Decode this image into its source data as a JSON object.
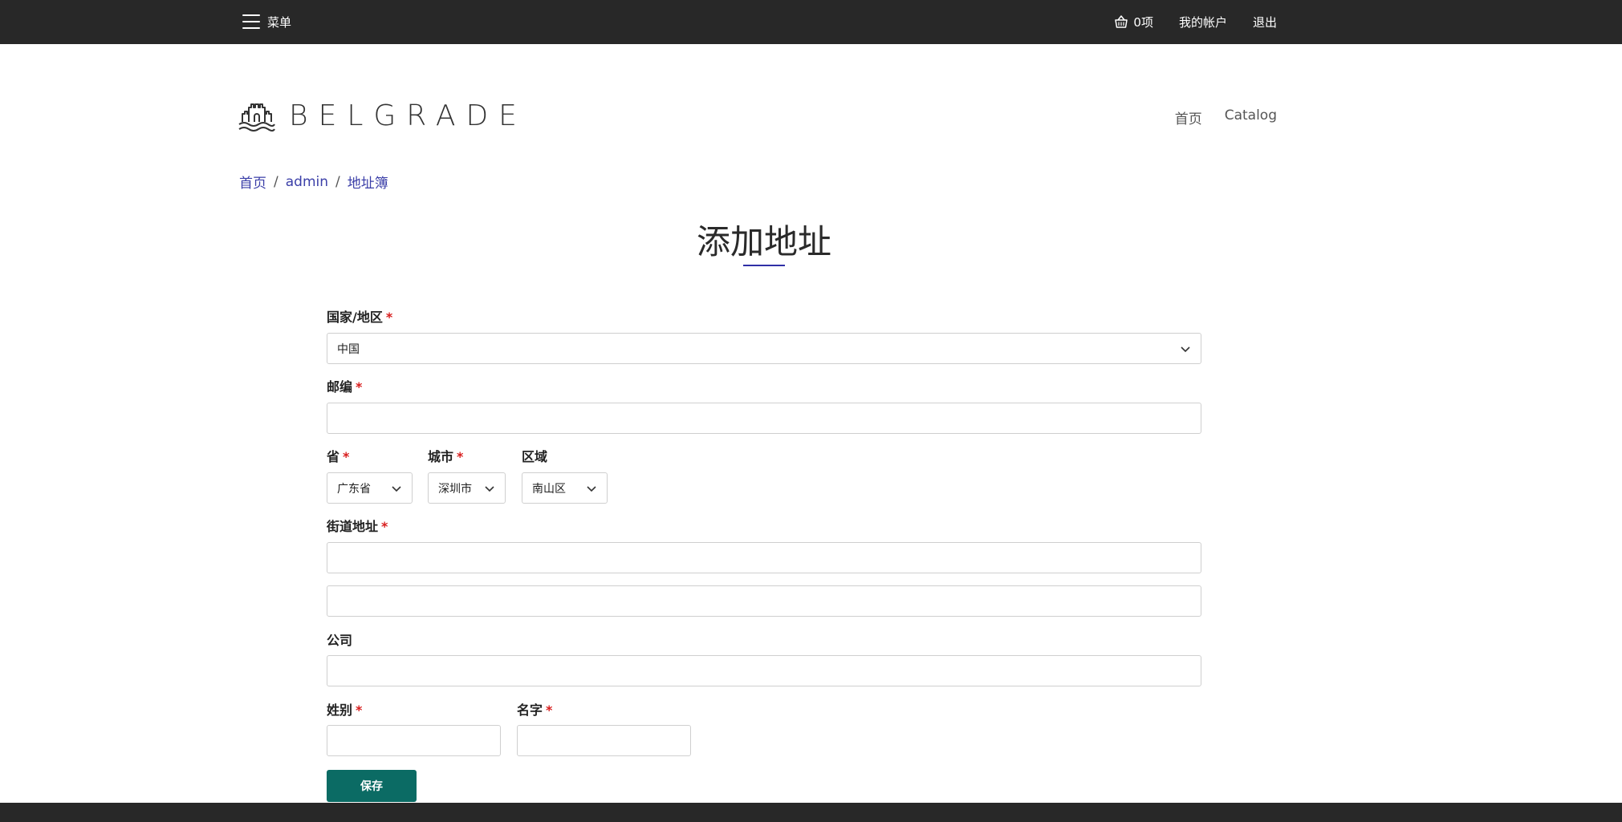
{
  "topbar": {
    "menu_label": "菜单",
    "cart_count": "0项",
    "account_label": "我的帐户",
    "logout_label": "退出"
  },
  "header": {
    "logo_text": "BELGRADE",
    "nav": [
      "首页",
      "Catalog"
    ]
  },
  "breadcrumb": [
    "首页",
    "admin",
    "地址簿"
  ],
  "page": {
    "title": "添加地址"
  },
  "form": {
    "country_label": "国家/地区",
    "country_value": "中国",
    "postcode_label": "邮编",
    "province_label": "省",
    "province_value": "广东省",
    "city_label": "城市",
    "city_value": "深圳市",
    "district_label": "区域",
    "district_value": "南山区",
    "street_label": "街道地址",
    "company_label": "公司",
    "lastname_label": "姓别",
    "firstname_label": "名字",
    "required_mark": "*",
    "save_label": "保存"
  },
  "colors": {
    "topbar_bg": "#282828",
    "link": "#3b3fa8",
    "required": "#d81d1d",
    "save_button": "#0b6b64"
  }
}
